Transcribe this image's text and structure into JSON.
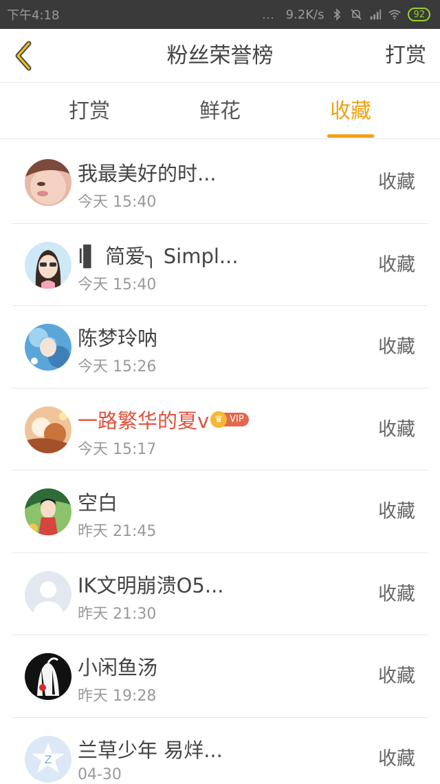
{
  "status_bar": {
    "time": "下午4:18",
    "dots": "...",
    "network_speed": "9.2K/s",
    "battery": "92"
  },
  "nav": {
    "title": "粉丝荣誉榜",
    "right_action": "打赏"
  },
  "tabs": [
    {
      "label": "打赏",
      "active": false
    },
    {
      "label": "鲜花",
      "active": false
    },
    {
      "label": "收藏",
      "active": true
    }
  ],
  "accent_color": "#f5a20f",
  "vip_name_color": "#e2503a",
  "rows": [
    {
      "name": "我最美好的时...",
      "time": "今天 15:40",
      "action": "收藏"
    },
    {
      "name": "I▌ 简爱╮ Simpl...",
      "time": "今天 15:40",
      "action": "收藏"
    },
    {
      "name": "陈梦玲呐",
      "time": "今天 15:26",
      "action": "收藏"
    },
    {
      "name": "一路繁华的夏v",
      "time": "今天 15:17",
      "action": "收藏",
      "vip": true,
      "vip_label": "VIP"
    },
    {
      "name": "空白",
      "time": "昨天 21:45",
      "action": "收藏"
    },
    {
      "name": "IK文明崩溃O5...",
      "time": "昨天 21:30",
      "action": "收藏"
    },
    {
      "name": "小闲鱼汤",
      "time": "昨天 19:28",
      "action": "收藏"
    },
    {
      "name": "兰草少年 易烊...",
      "time": "04-30",
      "action": "收藏"
    }
  ]
}
